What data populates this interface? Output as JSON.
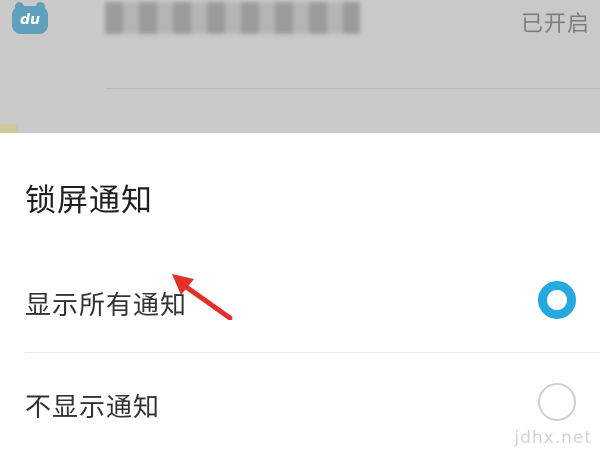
{
  "background_list": {
    "app_icon_text": "du",
    "status": "已开启"
  },
  "dialog": {
    "title": "锁屏通知",
    "options": [
      {
        "label": "显示所有通知",
        "selected": true
      },
      {
        "label": "不显示通知",
        "selected": false
      }
    ]
  },
  "colors": {
    "accent": "#24a9e1",
    "annotation_arrow": "#e0302a",
    "overlay": "#c9c9c9"
  },
  "watermark": "jdhx.net"
}
